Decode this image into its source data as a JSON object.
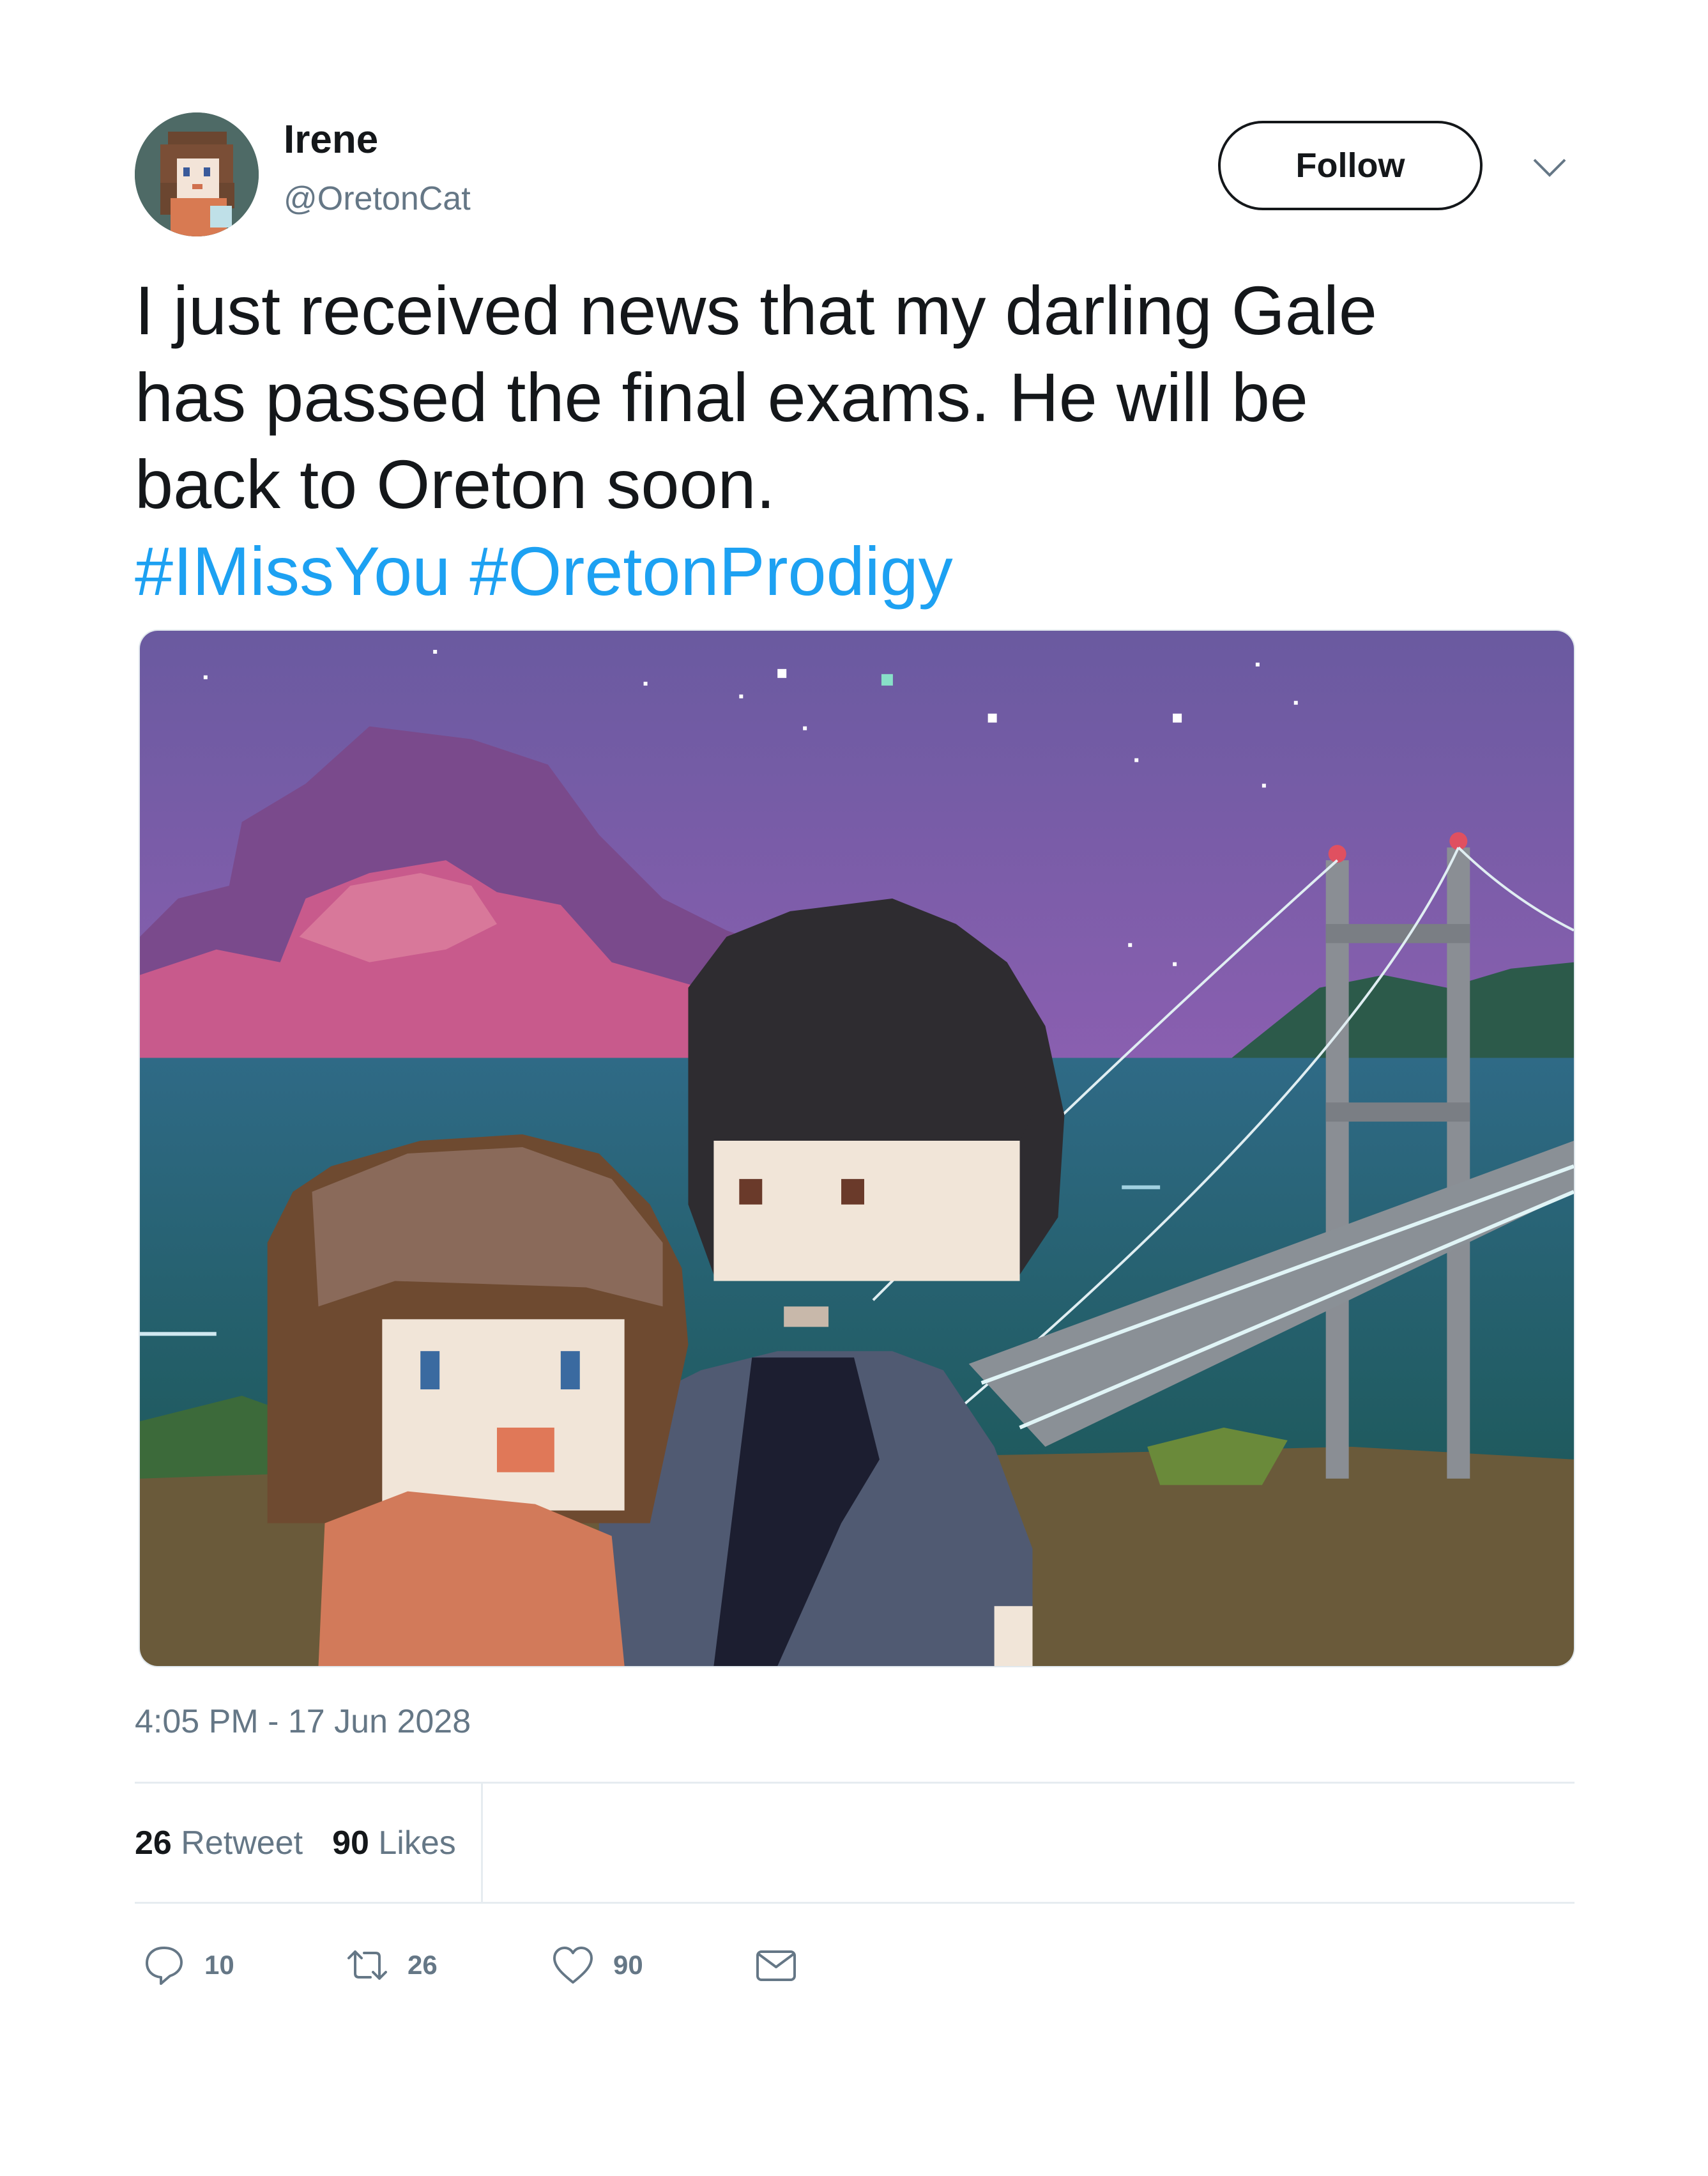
{
  "user": {
    "display_name": "Irene",
    "handle": "@OretonCat",
    "avatar_icon": "pixel-girl-avatar"
  },
  "header": {
    "follow_label": "Follow",
    "more_icon": "chevron-down-icon"
  },
  "tweet": {
    "text_lines": [
      "I just received news that my darling Gale",
      "has passed the final exams. He will be",
      "back to Oreton soon."
    ],
    "hashtags": [
      "#IMissYou",
      "#OretonProdigy"
    ],
    "hashtag_color": "#1da1f2",
    "media_description_icon": "pixel-art-couple-bridge-night-image"
  },
  "meta": {
    "timestamp": "4:05 PM - 17 Jun 2028"
  },
  "stats": {
    "retweets_count": "26",
    "retweets_label": "Retweet",
    "likes_count": "90",
    "likes_label": "Likes"
  },
  "actions": {
    "reply_count": "10",
    "retweet_count": "26",
    "like_count": "90",
    "icons": [
      "reply-icon",
      "retweet-icon",
      "heart-icon",
      "envelope-icon"
    ]
  },
  "colors": {
    "text": "#14171a",
    "secondary": "#657786",
    "divider": "#e6ecf0",
    "link": "#1da1f2"
  }
}
